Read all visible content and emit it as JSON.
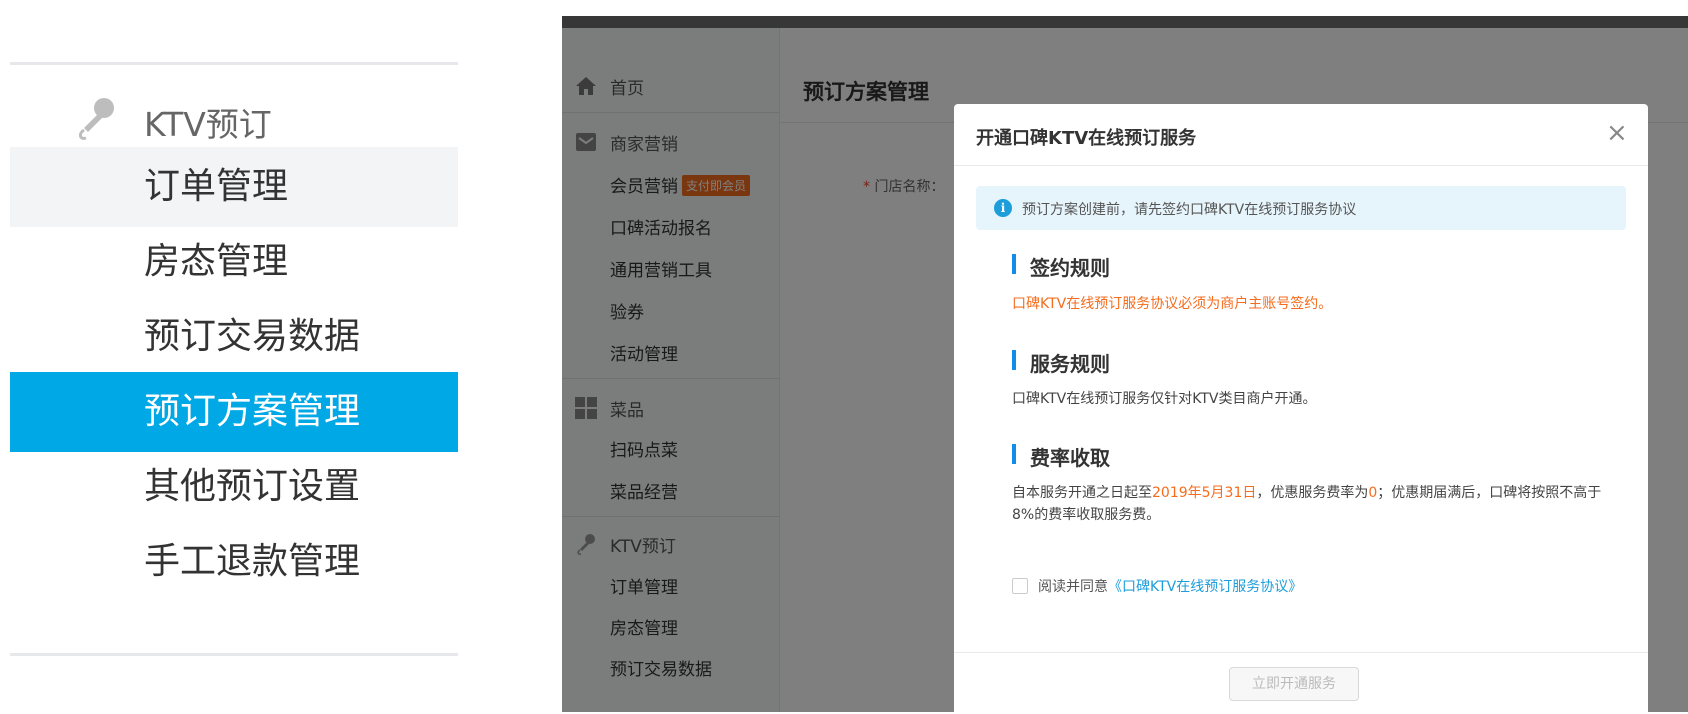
{
  "left_menu": {
    "group_label": "KTV预订",
    "group_icon": "microphone-icon",
    "items": [
      {
        "label": "订单管理",
        "state": "hover"
      },
      {
        "label": "房态管理",
        "state": "normal"
      },
      {
        "label": "预订交易数据",
        "state": "normal"
      },
      {
        "label": "预订方案管理",
        "state": "active"
      },
      {
        "label": "其他预订设置",
        "state": "normal"
      },
      {
        "label": "手工退款管理",
        "state": "normal"
      }
    ],
    "active_color": "#00a8e6"
  },
  "sidebar": {
    "home": {
      "label": "首页",
      "icon": "home-icon"
    },
    "marketing": {
      "label": "商家营销",
      "icon": "mail-icon"
    },
    "marketing_items": [
      "会员营销",
      "口碑活动报名",
      "通用营销工具",
      "验券",
      "活动管理"
    ],
    "member_badge": "支付即会员",
    "dishes": {
      "label": "菜品",
      "icon": "grid-icon"
    },
    "dishes_items": [
      "扫码点菜",
      "菜品经营"
    ],
    "ktv": {
      "label": "KTV预订",
      "icon": "microphone-icon"
    },
    "ktv_items": [
      "订单管理",
      "房态管理",
      "预订交易数据"
    ]
  },
  "main": {
    "page_title": "预订方案管理",
    "store_name_label": "门店名称："
  },
  "modal": {
    "title": "开通口碑KTV在线预订服务",
    "close": "×",
    "alert_text": "预订方案创建前，请先签约口碑KTV在线预订服务协议",
    "sections": {
      "signing": {
        "title": "签约规则",
        "text": "口碑KTV在线预订服务协议必须为商户主账号签约。"
      },
      "service": {
        "title": "服务规则",
        "text": "口碑KTV在线预订服务仅针对KTV类目商户开通。"
      },
      "fee": {
        "title": "费率收取",
        "text_1": "自本服务开通之日起至",
        "date": "2019年5月31日",
        "text_2": "，优惠服务费率为",
        "rate": "0",
        "text_3": "；优惠期届满后，口碑将按照不高于8%的费率收取服务费。"
      }
    },
    "agree_prefix": "阅读并同意",
    "agree_link": "《口碑KTV在线预订服务协议》",
    "agree_checked": false,
    "submit_label": "立即开通服务",
    "accent": "#1d9dd9",
    "warning_color": "#f56c1d"
  }
}
